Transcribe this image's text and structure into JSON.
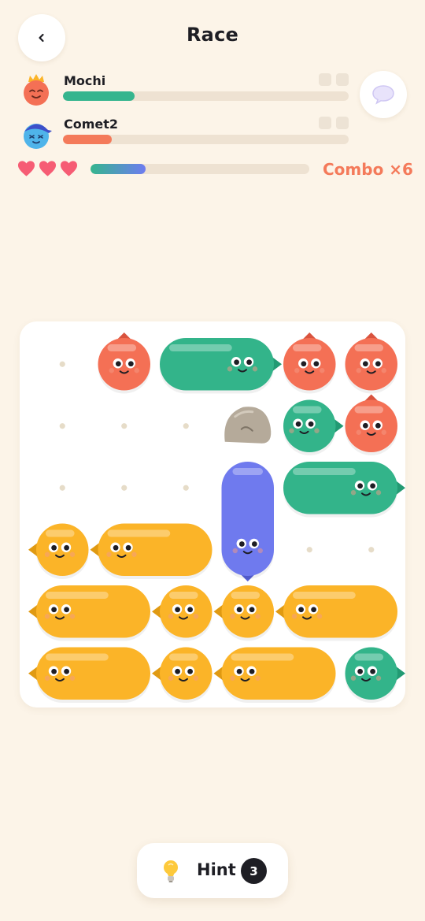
{
  "header": {
    "title": "Race",
    "back_icon": "chevron-left-icon",
    "chat_icon": "speech-bubble-icon"
  },
  "players": [
    {
      "name": "Mochi",
      "progress": 0.25,
      "color": "#35B58E",
      "avatar": "crowned-red-face",
      "slots": 2
    },
    {
      "name": "Comet2",
      "progress": 0.17,
      "color": "#F47A5A",
      "avatar": "blue-face-with-cap",
      "slots": 2
    }
  ],
  "status": {
    "hearts": 3,
    "combo_progress": 0.25,
    "combo_label": "Combo ×6"
  },
  "board": {
    "rows": 6,
    "cols": 6,
    "colors": {
      "red": "#F47055",
      "green": "#33B48A",
      "yellow": "#FBB428",
      "blue": "#6F7AEE",
      "rock": "#B5AA9A"
    },
    "empty_cells": [
      [
        0,
        0
      ],
      [
        1,
        0
      ],
      [
        1,
        1
      ],
      [
        1,
        2
      ],
      [
        2,
        0
      ],
      [
        2,
        1
      ],
      [
        2,
        2
      ],
      [
        3,
        4
      ],
      [
        3,
        5
      ]
    ],
    "pieces": [
      {
        "color": "red",
        "row": 0,
        "col": 1,
        "len": 1,
        "dir": "up"
      },
      {
        "color": "green",
        "row": 0,
        "col": 2,
        "len": 2,
        "dir": "right"
      },
      {
        "color": "red",
        "row": 0,
        "col": 4,
        "len": 1,
        "dir": "up"
      },
      {
        "color": "red",
        "row": 0,
        "col": 5,
        "len": 1,
        "dir": "up"
      },
      {
        "color": "rock",
        "row": 1,
        "col": 3,
        "len": 1,
        "dir": "none"
      },
      {
        "color": "green",
        "row": 1,
        "col": 4,
        "len": 1,
        "dir": "right"
      },
      {
        "color": "red",
        "row": 1,
        "col": 5,
        "len": 1,
        "dir": "up"
      },
      {
        "color": "blue",
        "row": 2,
        "col": 3,
        "len": 2,
        "dir": "down"
      },
      {
        "color": "green",
        "row": 2,
        "col": 4,
        "len": 2,
        "dir": "right"
      },
      {
        "color": "yellow",
        "row": 3,
        "col": 0,
        "len": 1,
        "dir": "left"
      },
      {
        "color": "yellow",
        "row": 3,
        "col": 1,
        "len": 2,
        "dir": "left"
      },
      {
        "color": "yellow",
        "row": 4,
        "col": 0,
        "len": 2,
        "dir": "left"
      },
      {
        "color": "yellow",
        "row": 4,
        "col": 2,
        "len": 1,
        "dir": "left"
      },
      {
        "color": "yellow",
        "row": 4,
        "col": 3,
        "len": 1,
        "dir": "left"
      },
      {
        "color": "yellow",
        "row": 4,
        "col": 4,
        "len": 2,
        "dir": "left"
      },
      {
        "color": "yellow",
        "row": 5,
        "col": 0,
        "len": 2,
        "dir": "left"
      },
      {
        "color": "yellow",
        "row": 5,
        "col": 2,
        "len": 1,
        "dir": "left"
      },
      {
        "color": "yellow",
        "row": 5,
        "col": 3,
        "len": 2,
        "dir": "left"
      },
      {
        "color": "green",
        "row": 5,
        "col": 5,
        "len": 1,
        "dir": "right"
      }
    ]
  },
  "hint": {
    "label": "Hint",
    "count": "3",
    "icon": "lightbulb-icon"
  }
}
